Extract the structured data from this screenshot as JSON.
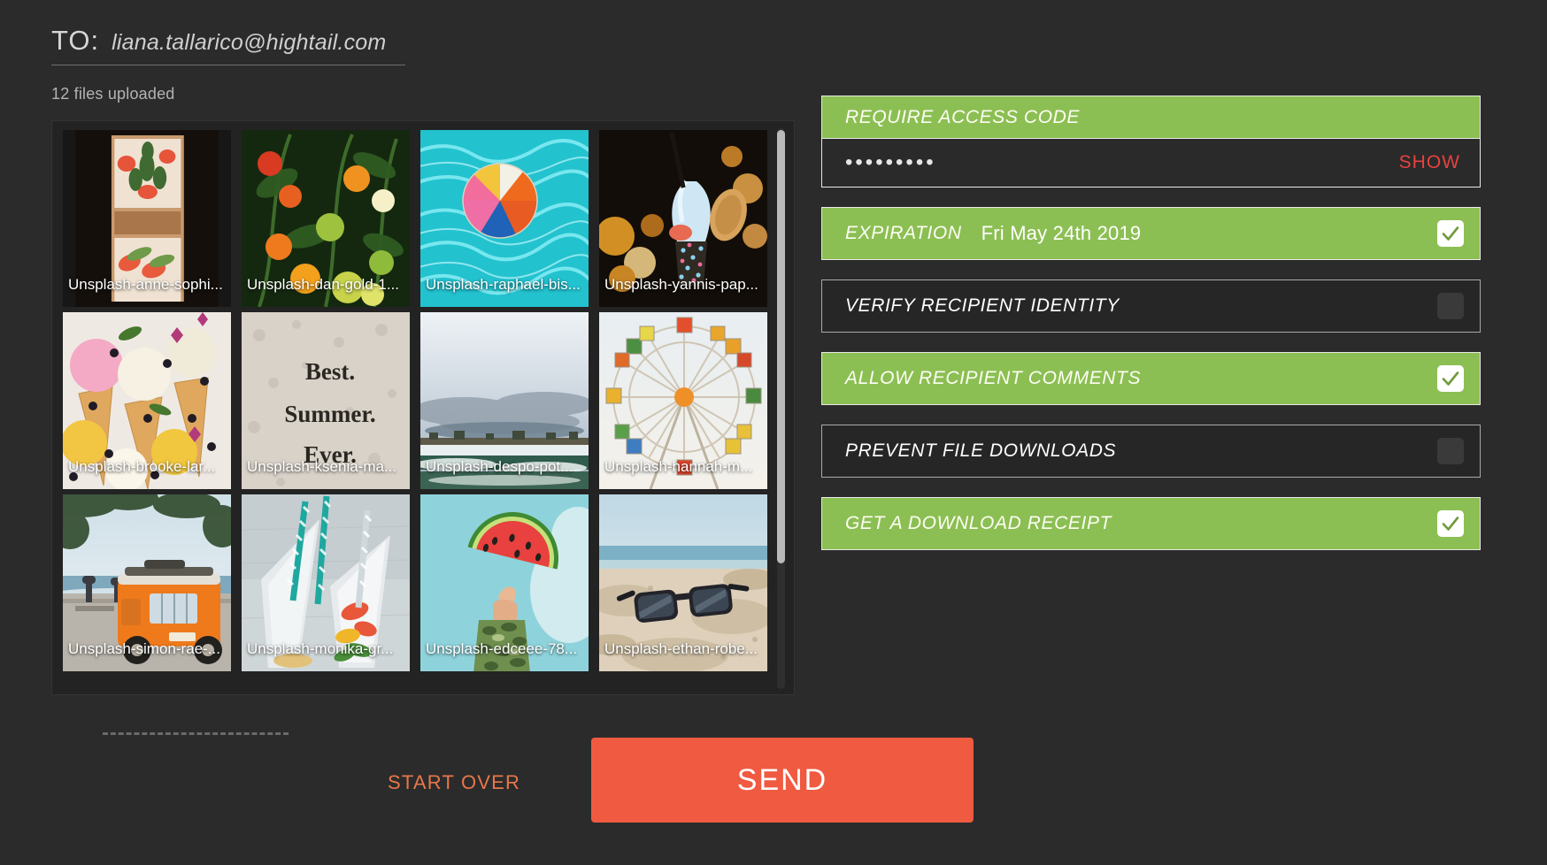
{
  "header": {
    "to_label": "TO:",
    "to_value": "liana.tallarico@hightail.com",
    "files_count": "12 files uploaded"
  },
  "files": [
    {
      "name": "Unsplash-anne-sophi...",
      "art": "veggie-board"
    },
    {
      "name": "Unsplash-dan-gold-1...",
      "art": "tomatoes"
    },
    {
      "name": "Unsplash-raphael-bis...",
      "art": "beachball-pool"
    },
    {
      "name": "Unsplash-yannis-pap...",
      "art": "icecream-bokeh"
    },
    {
      "name": "Unsplash-brooke-lar...",
      "art": "icecream-cones"
    },
    {
      "name": "Unsplash-ksenia-ma...",
      "art": "best-summer-ever"
    },
    {
      "name": "Unsplash-despo-pot...",
      "art": "sea-horizon"
    },
    {
      "name": "Unsplash-hannah-m...",
      "art": "ferris-wheel"
    },
    {
      "name": "Unsplash-simon-rae-...",
      "art": "orange-van"
    },
    {
      "name": "Unsplash-monika-gr...",
      "art": "cocktails-straws"
    },
    {
      "name": "Unsplash-edceee-78...",
      "art": "watermelon-slice"
    },
    {
      "name": "Unsplash-ethan-robe...",
      "art": "sunglasses-beach"
    }
  ],
  "options": {
    "access_code": {
      "label": "REQUIRE ACCESS CODE",
      "value_masked": "•••••••••",
      "show_label": "SHOW",
      "enabled": true
    },
    "items": [
      {
        "label": "EXPIRATION",
        "value": "Fri May 24th 2019",
        "checked": true
      },
      {
        "label": "VERIFY RECIPIENT IDENTITY",
        "value": "",
        "checked": false
      },
      {
        "label": "ALLOW RECIPIENT COMMENTS",
        "value": "",
        "checked": true
      },
      {
        "label": "PREVENT FILE DOWNLOADS",
        "value": "",
        "checked": false
      },
      {
        "label": "GET A DOWNLOAD RECEIPT",
        "value": "",
        "checked": true
      }
    ]
  },
  "footer": {
    "start_over": "START OVER",
    "send": "SEND"
  },
  "colors": {
    "background": "#2b2b2b",
    "option_on": "#8cbf53",
    "option_off": "#262626",
    "send_button": "#f05a41",
    "start_over_text": "#e8774a",
    "show_link": "#e8413f"
  }
}
